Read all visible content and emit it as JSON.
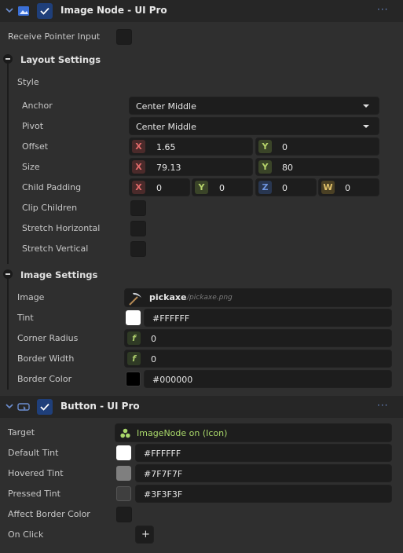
{
  "image_node": {
    "title": "Image Node - UI Pro",
    "more": "···",
    "receive_pointer_input": "Receive Pointer Input",
    "layout_settings": {
      "title": "Layout Settings",
      "style_label": "Style",
      "anchor": {
        "label": "Anchor",
        "value": "Center Middle"
      },
      "pivot": {
        "label": "Pivot",
        "value": "Center Middle"
      },
      "offset": {
        "label": "Offset",
        "x_tag": "X",
        "x": "1.65",
        "y_tag": "Y",
        "y": "0"
      },
      "size": {
        "label": "Size",
        "x_tag": "X",
        "x": "79.13",
        "y_tag": "Y",
        "y": "80"
      },
      "child_padding": {
        "label": "Child Padding",
        "x_tag": "X",
        "x": "0",
        "y_tag": "Y",
        "y": "0",
        "z_tag": "Z",
        "z": "0",
        "w_tag": "W",
        "w": "0"
      },
      "clip_children": "Clip Children",
      "stretch_horizontal": "Stretch Horizontal",
      "stretch_vertical": "Stretch Vertical"
    },
    "image_settings": {
      "title": "Image Settings",
      "image": {
        "label": "Image",
        "name": "pickaxe",
        "path": "/pickaxe.png"
      },
      "tint": {
        "label": "Tint",
        "value": "#FFFFFF",
        "color": "#FFFFFF"
      },
      "corner_radius": {
        "label": "Corner Radius",
        "tag": "f",
        "value": "0"
      },
      "border_width": {
        "label": "Border Width",
        "tag": "f",
        "value": "0"
      },
      "border_color": {
        "label": "Border Color",
        "value": "#000000",
        "color": "#000000"
      }
    }
  },
  "button": {
    "title": "Button - UI Pro",
    "more": "···",
    "target": {
      "label": "Target",
      "value": "ImageNode on (Icon)"
    },
    "default_tint": {
      "label": "Default Tint",
      "value": "#FFFFFF",
      "color": "#FFFFFF"
    },
    "hovered_tint": {
      "label": "Hovered Tint",
      "value": "#7F7F7F",
      "color": "#7F7F7F"
    },
    "pressed_tint": {
      "label": "Pressed Tint",
      "value": "#3F3F3F",
      "color": "#3F3F3F"
    },
    "affect_border_color": "Affect Border Color",
    "on_click": {
      "label": "On Click",
      "add": "+"
    }
  },
  "colors": {
    "accent": "#1f3f7a",
    "target_text": "#a9d86a"
  }
}
